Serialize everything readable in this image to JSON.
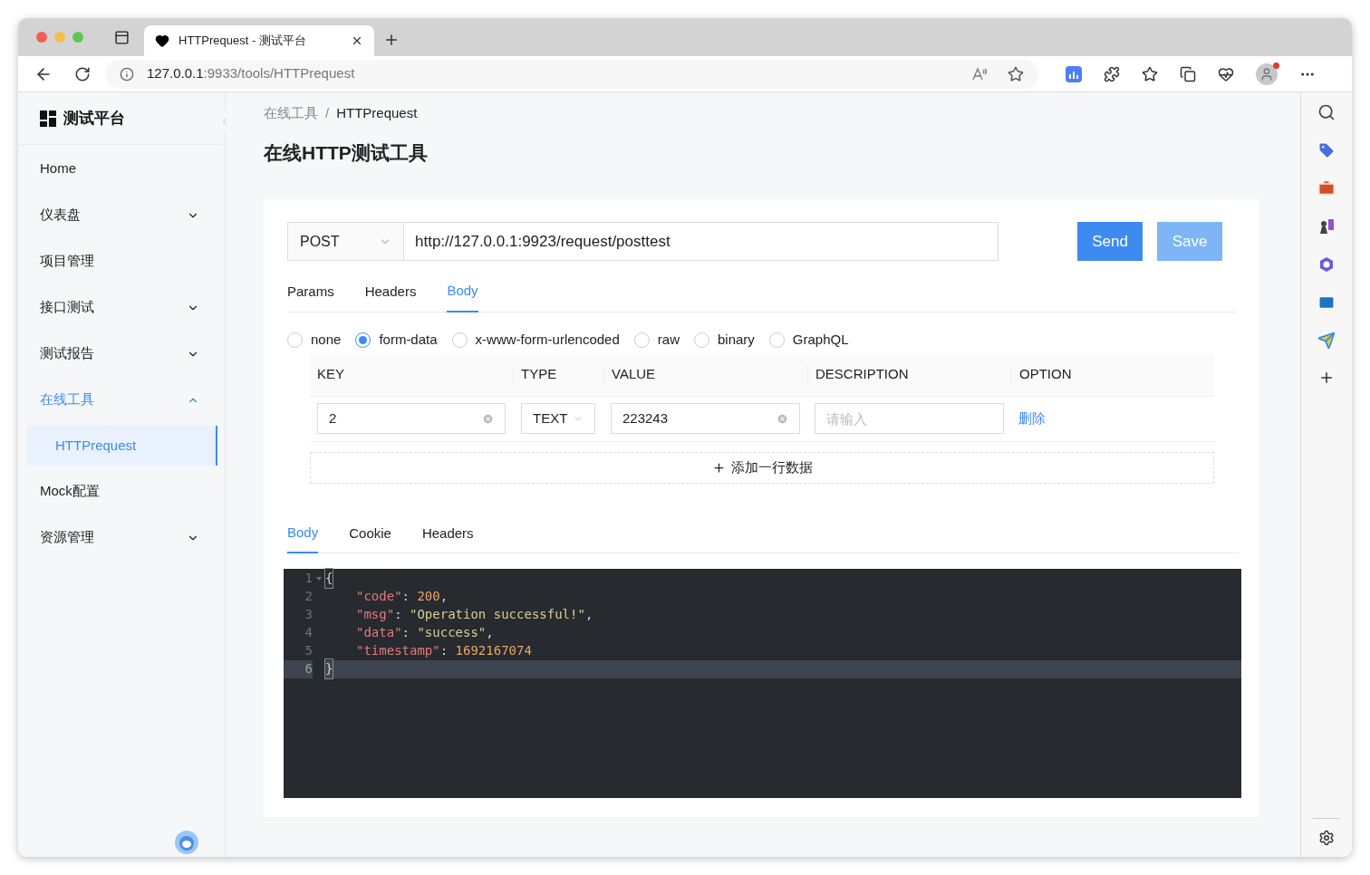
{
  "browser": {
    "tab_title": "HTTPrequest - 测试平台",
    "url_host": "127.0.0.1",
    "url_rest": ":9933/tools/HTTPrequest"
  },
  "sidebar": {
    "logo": "测试平台",
    "items": [
      {
        "label": "Home",
        "expandable": false,
        "active": false
      },
      {
        "label": "仪表盘",
        "expandable": true,
        "expanded": false,
        "active": false
      },
      {
        "label": "项目管理",
        "expandable": false,
        "active": false
      },
      {
        "label": "接口测试",
        "expandable": true,
        "expanded": false,
        "active": false
      },
      {
        "label": "测试报告",
        "expandable": true,
        "expanded": false,
        "active": false
      },
      {
        "label": "在线工具",
        "expandable": true,
        "expanded": true,
        "active": true,
        "children": [
          {
            "label": "HTTPrequest",
            "selected": true
          }
        ]
      },
      {
        "label": "Mock配置",
        "expandable": false,
        "active": false
      },
      {
        "label": "资源管理",
        "expandable": true,
        "expanded": false,
        "active": false
      }
    ]
  },
  "breadcrumb": {
    "items": [
      "在线工具",
      "HTTPrequest"
    ],
    "separator": "/"
  },
  "page_title": "在线HTTP测试工具",
  "request": {
    "method": "POST",
    "url": "http://127.0.0.1:9923/request/posttest",
    "buttons": [
      {
        "label": "Send",
        "kind": "primary"
      },
      {
        "label": "Save",
        "kind": "light"
      }
    ],
    "tabs": [
      {
        "label": "Params",
        "selected": false
      },
      {
        "label": "Headers",
        "selected": false
      },
      {
        "label": "Body",
        "selected": true
      }
    ],
    "body_types": [
      {
        "label": "none",
        "selected": false
      },
      {
        "label": "form-data",
        "selected": true
      },
      {
        "label": "x-www-form-urlencoded",
        "selected": false
      },
      {
        "label": "raw",
        "selected": false
      },
      {
        "label": "binary",
        "selected": false
      },
      {
        "label": "GraphQL",
        "selected": false
      }
    ],
    "table": {
      "columns": [
        "KEY",
        "TYPE",
        "VALUE",
        "DESCRIPTION",
        "OPTION"
      ],
      "rows": [
        {
          "key": "2",
          "type": "TEXT",
          "value": "223243",
          "description_placeholder": "请输入",
          "action": "删除"
        }
      ]
    },
    "add_row": "添加一行数据"
  },
  "response": {
    "tabs": [
      {
        "label": "Body",
        "selected": true
      },
      {
        "label": "Cookie",
        "selected": false
      },
      {
        "label": "Headers",
        "selected": false
      }
    ],
    "code_lines": [
      {
        "number": "1",
        "foldable": true,
        "active": false,
        "indented": false,
        "tokens": [
          {
            "kind": "punct",
            "text": "{",
            "matched": true
          }
        ]
      },
      {
        "number": "2",
        "foldable": false,
        "active": false,
        "indented": true,
        "tokens": [
          {
            "kind": "key",
            "text": "\"code\"",
            "matched": false
          },
          {
            "kind": "punct",
            "text": ": ",
            "matched": false
          },
          {
            "kind": "number",
            "text": "200",
            "matched": false
          },
          {
            "kind": "punct",
            "text": ",",
            "matched": false
          }
        ]
      },
      {
        "number": "3",
        "foldable": false,
        "active": false,
        "indented": true,
        "tokens": [
          {
            "kind": "key",
            "text": "\"msg\"",
            "matched": false
          },
          {
            "kind": "punct",
            "text": ": ",
            "matched": false
          },
          {
            "kind": "string",
            "text": "\"Operation successful!\"",
            "matched": false
          },
          {
            "kind": "punct",
            "text": ",",
            "matched": false
          }
        ]
      },
      {
        "number": "4",
        "foldable": false,
        "active": false,
        "indented": true,
        "tokens": [
          {
            "kind": "key",
            "text": "\"data\"",
            "matched": false
          },
          {
            "kind": "punct",
            "text": ": ",
            "matched": false
          },
          {
            "kind": "string",
            "text": "\"success\"",
            "matched": false
          },
          {
            "kind": "punct",
            "text": ",",
            "matched": false
          }
        ]
      },
      {
        "number": "5",
        "foldable": false,
        "active": false,
        "indented": true,
        "tokens": [
          {
            "kind": "key",
            "text": "\"timestamp\"",
            "matched": false
          },
          {
            "kind": "punct",
            "text": ": ",
            "matched": false
          },
          {
            "kind": "number",
            "text": "1692167074",
            "matched": false
          }
        ]
      },
      {
        "number": "6",
        "foldable": false,
        "active": true,
        "indented": false,
        "tokens": [
          {
            "kind": "punct",
            "text": "}",
            "matched": true
          }
        ]
      }
    ]
  }
}
